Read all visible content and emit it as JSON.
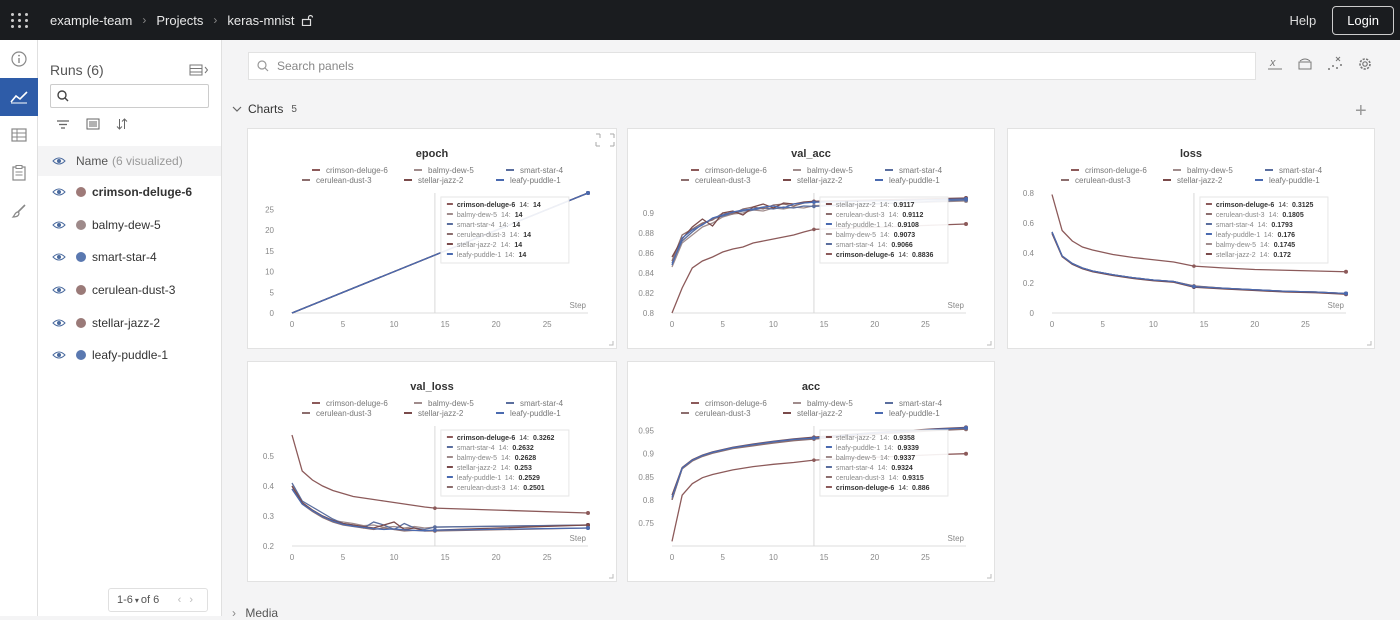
{
  "topbar": {
    "breadcrumbs": [
      "example-team",
      "Projects",
      "keras-mnist"
    ],
    "help_label": "Help",
    "login_label": "Login"
  },
  "runs_panel": {
    "title": "Runs (6)",
    "search_value": "",
    "name_header": "Name",
    "visualized_label": "(6 visualized)",
    "runs": [
      {
        "name": "crimson-deluge-6",
        "color": "#9e7a78",
        "bold": true
      },
      {
        "name": "balmy-dew-5",
        "color": "#9e8a8a",
        "bold": false
      },
      {
        "name": "smart-star-4",
        "color": "#5a78b0",
        "bold": false
      },
      {
        "name": "cerulean-dust-3",
        "color": "#9a7a78",
        "bold": false
      },
      {
        "name": "stellar-jazz-2",
        "color": "#9a7a78",
        "bold": false
      },
      {
        "name": "leafy-puddle-1",
        "color": "#5a78b0",
        "bold": false
      }
    ],
    "pager": {
      "range": "1-6",
      "of_label": "of 6"
    }
  },
  "main": {
    "search_placeholder": "Search panels",
    "charts_section": {
      "label": "Charts",
      "count": "5"
    },
    "bottom_section_label": "Media"
  },
  "legend_names": [
    "crimson-deluge-6",
    "balmy-dew-5",
    "smart-star-4",
    "cerulean-dust-3",
    "stellar-jazz-2",
    "leafy-puddle-1"
  ],
  "series_colors": {
    "crimson-deluge-6": "#8c5a5a",
    "balmy-dew-5": "#a08c8c",
    "smart-star-4": "#5a6e9e",
    "cerulean-dust-3": "#8c6e6e",
    "stellar-jazz-2": "#7a4a4a",
    "leafy-puddle-1": "#4a6ab0"
  },
  "chart_data": [
    {
      "type": "line",
      "title": "epoch",
      "xlabel": "Step",
      "xlim": [
        0,
        29
      ],
      "ylim": [
        0,
        29
      ],
      "xticks": [
        0,
        5,
        10,
        15,
        20,
        25
      ],
      "yticks": [
        0,
        5,
        10,
        15,
        20,
        25
      ],
      "x": [
        0,
        29
      ],
      "series": [
        {
          "name": "crimson-deluge-6",
          "values": [
            0,
            29
          ]
        },
        {
          "name": "balmy-dew-5",
          "values": [
            0,
            29
          ]
        },
        {
          "name": "smart-star-4",
          "values": [
            0,
            29
          ]
        },
        {
          "name": "cerulean-dust-3",
          "values": [
            0,
            29
          ]
        },
        {
          "name": "stellar-jazz-2",
          "values": [
            0,
            29
          ]
        },
        {
          "name": "leafy-puddle-1",
          "values": [
            0,
            29
          ]
        }
      ],
      "hover_step": 14,
      "tooltip": [
        {
          "name": "crimson-deluge-6",
          "step": "14",
          "value": "14",
          "bold": true
        },
        {
          "name": "balmy-dew-5",
          "step": "14",
          "value": "14"
        },
        {
          "name": "smart-star-4",
          "step": "14",
          "value": "14"
        },
        {
          "name": "cerulean-dust-3",
          "step": "14",
          "value": "14"
        },
        {
          "name": "stellar-jazz-2",
          "step": "14",
          "value": "14"
        },
        {
          "name": "leafy-puddle-1",
          "step": "14",
          "value": "14"
        }
      ]
    },
    {
      "type": "line",
      "title": "val_acc",
      "xlabel": "Step",
      "xlim": [
        0,
        29
      ],
      "ylim": [
        0.8,
        0.92
      ],
      "xticks": [
        0,
        5,
        10,
        15,
        20,
        25
      ],
      "yticks": [
        0.8,
        0.82,
        0.84,
        0.86,
        0.88,
        0.9
      ],
      "x": [
        0,
        1,
        2,
        3,
        4,
        5,
        6,
        7,
        8,
        9,
        10,
        11,
        12,
        13,
        14,
        29
      ],
      "series": [
        {
          "name": "crimson-deluge-6",
          "values": [
            0.8,
            0.825,
            0.845,
            0.852,
            0.856,
            0.861,
            0.864,
            0.866,
            0.87,
            0.872,
            0.874,
            0.876,
            0.878,
            0.881,
            0.8836,
            0.889
          ]
        },
        {
          "name": "balmy-dew-5",
          "values": [
            0.846,
            0.87,
            0.878,
            0.886,
            0.89,
            0.896,
            0.899,
            0.9,
            0.903,
            0.902,
            0.905,
            0.904,
            0.906,
            0.905,
            0.9073,
            0.912
          ]
        },
        {
          "name": "smart-star-4",
          "values": [
            0.85,
            0.872,
            0.881,
            0.889,
            0.894,
            0.897,
            0.9,
            0.902,
            0.903,
            0.905,
            0.904,
            0.906,
            0.905,
            0.907,
            0.9066,
            0.913
          ]
        },
        {
          "name": "cerulean-dust-3",
          "values": [
            0.852,
            0.878,
            0.884,
            0.89,
            0.893,
            0.9,
            0.899,
            0.904,
            0.906,
            0.904,
            0.908,
            0.909,
            0.907,
            0.91,
            0.9112,
            0.914
          ]
        },
        {
          "name": "stellar-jazz-2",
          "values": [
            0.856,
            0.874,
            0.886,
            0.894,
            0.887,
            0.9,
            0.902,
            0.898,
            0.906,
            0.909,
            0.905,
            0.91,
            0.909,
            0.911,
            0.9117,
            0.915
          ]
        },
        {
          "name": "leafy-puddle-1",
          "values": [
            0.848,
            0.875,
            0.883,
            0.888,
            0.895,
            0.898,
            0.901,
            0.903,
            0.904,
            0.906,
            0.907,
            0.905,
            0.909,
            0.91,
            0.9108,
            0.914
          ]
        }
      ],
      "hover_step": 14,
      "tooltip": [
        {
          "name": "stellar-jazz-2",
          "step": "14",
          "value": "0.9117"
        },
        {
          "name": "cerulean-dust-3",
          "step": "14",
          "value": "0.9112"
        },
        {
          "name": "leafy-puddle-1",
          "step": "14",
          "value": "0.9108"
        },
        {
          "name": "balmy-dew-5",
          "step": "14",
          "value": "0.9073"
        },
        {
          "name": "smart-star-4",
          "step": "14",
          "value": "0.9066"
        },
        {
          "name": "crimson-deluge-6",
          "step": "14",
          "value": "0.8836",
          "bold": true
        }
      ]
    },
    {
      "type": "line",
      "title": "loss",
      "xlabel": "Step",
      "xlim": [
        0,
        29
      ],
      "ylim": [
        0,
        0.8
      ],
      "xticks": [
        0,
        5,
        10,
        15,
        20,
        25
      ],
      "yticks": [
        0,
        0.2,
        0.4,
        0.6,
        0.8
      ],
      "x": [
        0,
        1,
        2,
        3,
        4,
        6,
        8,
        10,
        12,
        14,
        17,
        20,
        23,
        26,
        29
      ],
      "series": [
        {
          "name": "crimson-deluge-6",
          "values": [
            0.79,
            0.55,
            0.48,
            0.44,
            0.42,
            0.39,
            0.37,
            0.355,
            0.34,
            0.3125,
            0.3,
            0.29,
            0.285,
            0.28,
            0.275
          ]
        },
        {
          "name": "balmy-dew-5",
          "values": [
            0.54,
            0.38,
            0.33,
            0.3,
            0.28,
            0.255,
            0.235,
            0.22,
            0.21,
            0.1745,
            0.165,
            0.155,
            0.145,
            0.14,
            0.13
          ]
        },
        {
          "name": "smart-star-4",
          "values": [
            0.54,
            0.38,
            0.33,
            0.3,
            0.28,
            0.255,
            0.235,
            0.22,
            0.21,
            0.1793,
            0.165,
            0.155,
            0.145,
            0.14,
            0.13
          ]
        },
        {
          "name": "cerulean-dust-3",
          "values": [
            0.54,
            0.38,
            0.33,
            0.3,
            0.28,
            0.255,
            0.235,
            0.22,
            0.21,
            0.1805,
            0.165,
            0.155,
            0.145,
            0.14,
            0.13
          ]
        },
        {
          "name": "stellar-jazz-2",
          "values": [
            0.53,
            0.375,
            0.325,
            0.295,
            0.275,
            0.25,
            0.23,
            0.215,
            0.205,
            0.172,
            0.16,
            0.15,
            0.14,
            0.135,
            0.125
          ]
        },
        {
          "name": "leafy-puddle-1",
          "values": [
            0.54,
            0.38,
            0.33,
            0.3,
            0.28,
            0.255,
            0.235,
            0.22,
            0.21,
            0.176,
            0.165,
            0.155,
            0.145,
            0.14,
            0.13
          ]
        }
      ],
      "hover_step": 14,
      "tooltip": [
        {
          "name": "crimson-deluge-6",
          "step": "14",
          "value": "0.3125",
          "bold": true
        },
        {
          "name": "cerulean-dust-3",
          "step": "14",
          "value": "0.1805"
        },
        {
          "name": "smart-star-4",
          "step": "14",
          "value": "0.1793"
        },
        {
          "name": "leafy-puddle-1",
          "step": "14",
          "value": "0.176"
        },
        {
          "name": "balmy-dew-5",
          "step": "14",
          "value": "0.1745"
        },
        {
          "name": "stellar-jazz-2",
          "step": "14",
          "value": "0.172"
        }
      ]
    },
    {
      "type": "line",
      "title": "val_loss",
      "xlabel": "Step",
      "xlim": [
        0,
        29
      ],
      "ylim": [
        0.2,
        0.6
      ],
      "xticks": [
        0,
        5,
        10,
        15,
        20,
        25
      ],
      "yticks": [
        0.2,
        0.3,
        0.4,
        0.5
      ],
      "x": [
        0,
        1,
        2,
        3,
        4,
        5,
        6,
        7,
        8,
        9,
        10,
        11,
        12,
        13,
        14,
        29
      ],
      "series": [
        {
          "name": "crimson-deluge-6",
          "values": [
            0.57,
            0.45,
            0.42,
            0.4,
            0.385,
            0.375,
            0.365,
            0.36,
            0.355,
            0.35,
            0.345,
            0.34,
            0.335,
            0.33,
            0.3262,
            0.31
          ]
        },
        {
          "name": "balmy-dew-5",
          "values": [
            0.4,
            0.34,
            0.32,
            0.3,
            0.285,
            0.28,
            0.275,
            0.268,
            0.27,
            0.262,
            0.265,
            0.26,
            0.265,
            0.26,
            0.2628,
            0.27
          ]
        },
        {
          "name": "smart-star-4",
          "values": [
            0.41,
            0.35,
            0.33,
            0.31,
            0.29,
            0.275,
            0.27,
            0.26,
            0.28,
            0.27,
            0.255,
            0.275,
            0.26,
            0.255,
            0.2632,
            0.27
          ]
        },
        {
          "name": "cerulean-dust-3",
          "values": [
            0.39,
            0.34,
            0.315,
            0.295,
            0.28,
            0.27,
            0.265,
            0.26,
            0.255,
            0.26,
            0.255,
            0.25,
            0.252,
            0.25,
            0.2501,
            0.26
          ]
        },
        {
          "name": "stellar-jazz-2",
          "values": [
            0.4,
            0.345,
            0.32,
            0.3,
            0.285,
            0.275,
            0.27,
            0.265,
            0.26,
            0.27,
            0.28,
            0.255,
            0.26,
            0.25,
            0.253,
            0.27
          ]
        },
        {
          "name": "leafy-puddle-1",
          "values": [
            0.39,
            0.34,
            0.318,
            0.298,
            0.283,
            0.272,
            0.266,
            0.262,
            0.258,
            0.255,
            0.257,
            0.254,
            0.252,
            0.251,
            0.2529,
            0.26
          ]
        }
      ],
      "hover_step": 14,
      "tooltip": [
        {
          "name": "crimson-deluge-6",
          "step": "14",
          "value": "0.3262",
          "bold": true
        },
        {
          "name": "smart-star-4",
          "step": "14",
          "value": "0.2632"
        },
        {
          "name": "balmy-dew-5",
          "step": "14",
          "value": "0.2628"
        },
        {
          "name": "stellar-jazz-2",
          "step": "14",
          "value": "0.253"
        },
        {
          "name": "leafy-puddle-1",
          "step": "14",
          "value": "0.2529"
        },
        {
          "name": "cerulean-dust-3",
          "step": "14",
          "value": "0.2501"
        }
      ]
    },
    {
      "type": "line",
      "title": "acc",
      "xlabel": "Step",
      "xlim": [
        0,
        29
      ],
      "ylim": [
        0.7,
        0.96
      ],
      "xticks": [
        0,
        5,
        10,
        15,
        20,
        25
      ],
      "yticks": [
        0.75,
        0.8,
        0.85,
        0.9,
        0.95
      ],
      "x": [
        0,
        1,
        2,
        3,
        4,
        6,
        8,
        10,
        12,
        14,
        17,
        20,
        23,
        26,
        29
      ],
      "series": [
        {
          "name": "crimson-deluge-6",
          "values": [
            0.71,
            0.81,
            0.835,
            0.848,
            0.855,
            0.865,
            0.872,
            0.877,
            0.881,
            0.886,
            0.889,
            0.892,
            0.895,
            0.898,
            0.9
          ]
        },
        {
          "name": "balmy-dew-5",
          "values": [
            0.8,
            0.868,
            0.885,
            0.895,
            0.902,
            0.912,
            0.919,
            0.925,
            0.93,
            0.9337,
            0.939,
            0.944,
            0.948,
            0.952,
            0.955
          ]
        },
        {
          "name": "smart-star-4",
          "values": [
            0.8,
            0.868,
            0.885,
            0.895,
            0.902,
            0.912,
            0.918,
            0.924,
            0.929,
            0.9324,
            0.938,
            0.943,
            0.947,
            0.951,
            0.954
          ]
        },
        {
          "name": "cerulean-dust-3",
          "values": [
            0.8,
            0.867,
            0.884,
            0.894,
            0.901,
            0.911,
            0.917,
            0.923,
            0.928,
            0.9315,
            0.937,
            0.942,
            0.946,
            0.95,
            0.953
          ]
        },
        {
          "name": "stellar-jazz-2",
          "values": [
            0.81,
            0.87,
            0.887,
            0.897,
            0.904,
            0.914,
            0.921,
            0.927,
            0.932,
            0.9358,
            0.941,
            0.946,
            0.95,
            0.954,
            0.957
          ]
        },
        {
          "name": "leafy-puddle-1",
          "values": [
            0.805,
            0.869,
            0.886,
            0.896,
            0.903,
            0.913,
            0.92,
            0.926,
            0.931,
            0.9339,
            0.94,
            0.945,
            0.949,
            0.953,
            0.956
          ]
        }
      ],
      "hover_step": 14,
      "tooltip": [
        {
          "name": "stellar-jazz-2",
          "step": "14",
          "value": "0.9358"
        },
        {
          "name": "leafy-puddle-1",
          "step": "14",
          "value": "0.9339"
        },
        {
          "name": "balmy-dew-5",
          "step": "14",
          "value": "0.9337"
        },
        {
          "name": "smart-star-4",
          "step": "14",
          "value": "0.9324"
        },
        {
          "name": "cerulean-dust-3",
          "step": "14",
          "value": "0.9315"
        },
        {
          "name": "crimson-deluge-6",
          "step": "14",
          "value": "0.886",
          "bold": true
        }
      ]
    }
  ]
}
